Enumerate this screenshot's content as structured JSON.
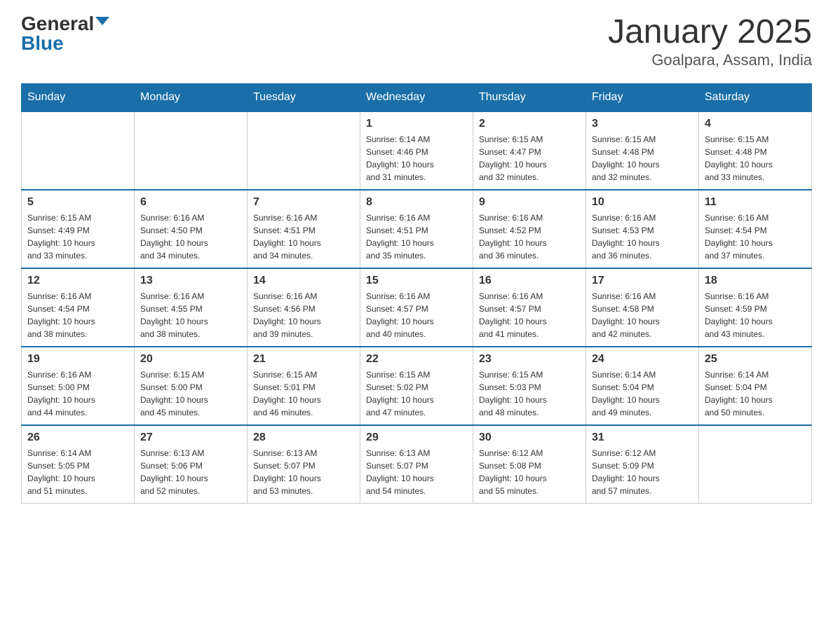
{
  "header": {
    "logo_general": "General",
    "logo_blue": "Blue",
    "title": "January 2025",
    "subtitle": "Goalpara, Assam, India"
  },
  "weekdays": [
    "Sunday",
    "Monday",
    "Tuesday",
    "Wednesday",
    "Thursday",
    "Friday",
    "Saturday"
  ],
  "weeks": [
    [
      {
        "day": "",
        "info": ""
      },
      {
        "day": "",
        "info": ""
      },
      {
        "day": "",
        "info": ""
      },
      {
        "day": "1",
        "info": "Sunrise: 6:14 AM\nSunset: 4:46 PM\nDaylight: 10 hours\nand 31 minutes."
      },
      {
        "day": "2",
        "info": "Sunrise: 6:15 AM\nSunset: 4:47 PM\nDaylight: 10 hours\nand 32 minutes."
      },
      {
        "day": "3",
        "info": "Sunrise: 6:15 AM\nSunset: 4:48 PM\nDaylight: 10 hours\nand 32 minutes."
      },
      {
        "day": "4",
        "info": "Sunrise: 6:15 AM\nSunset: 4:48 PM\nDaylight: 10 hours\nand 33 minutes."
      }
    ],
    [
      {
        "day": "5",
        "info": "Sunrise: 6:15 AM\nSunset: 4:49 PM\nDaylight: 10 hours\nand 33 minutes."
      },
      {
        "day": "6",
        "info": "Sunrise: 6:16 AM\nSunset: 4:50 PM\nDaylight: 10 hours\nand 34 minutes."
      },
      {
        "day": "7",
        "info": "Sunrise: 6:16 AM\nSunset: 4:51 PM\nDaylight: 10 hours\nand 34 minutes."
      },
      {
        "day": "8",
        "info": "Sunrise: 6:16 AM\nSunset: 4:51 PM\nDaylight: 10 hours\nand 35 minutes."
      },
      {
        "day": "9",
        "info": "Sunrise: 6:16 AM\nSunset: 4:52 PM\nDaylight: 10 hours\nand 36 minutes."
      },
      {
        "day": "10",
        "info": "Sunrise: 6:16 AM\nSunset: 4:53 PM\nDaylight: 10 hours\nand 36 minutes."
      },
      {
        "day": "11",
        "info": "Sunrise: 6:16 AM\nSunset: 4:54 PM\nDaylight: 10 hours\nand 37 minutes."
      }
    ],
    [
      {
        "day": "12",
        "info": "Sunrise: 6:16 AM\nSunset: 4:54 PM\nDaylight: 10 hours\nand 38 minutes."
      },
      {
        "day": "13",
        "info": "Sunrise: 6:16 AM\nSunset: 4:55 PM\nDaylight: 10 hours\nand 38 minutes."
      },
      {
        "day": "14",
        "info": "Sunrise: 6:16 AM\nSunset: 4:56 PM\nDaylight: 10 hours\nand 39 minutes."
      },
      {
        "day": "15",
        "info": "Sunrise: 6:16 AM\nSunset: 4:57 PM\nDaylight: 10 hours\nand 40 minutes."
      },
      {
        "day": "16",
        "info": "Sunrise: 6:16 AM\nSunset: 4:57 PM\nDaylight: 10 hours\nand 41 minutes."
      },
      {
        "day": "17",
        "info": "Sunrise: 6:16 AM\nSunset: 4:58 PM\nDaylight: 10 hours\nand 42 minutes."
      },
      {
        "day": "18",
        "info": "Sunrise: 6:16 AM\nSunset: 4:59 PM\nDaylight: 10 hours\nand 43 minutes."
      }
    ],
    [
      {
        "day": "19",
        "info": "Sunrise: 6:16 AM\nSunset: 5:00 PM\nDaylight: 10 hours\nand 44 minutes."
      },
      {
        "day": "20",
        "info": "Sunrise: 6:15 AM\nSunset: 5:00 PM\nDaylight: 10 hours\nand 45 minutes."
      },
      {
        "day": "21",
        "info": "Sunrise: 6:15 AM\nSunset: 5:01 PM\nDaylight: 10 hours\nand 46 minutes."
      },
      {
        "day": "22",
        "info": "Sunrise: 6:15 AM\nSunset: 5:02 PM\nDaylight: 10 hours\nand 47 minutes."
      },
      {
        "day": "23",
        "info": "Sunrise: 6:15 AM\nSunset: 5:03 PM\nDaylight: 10 hours\nand 48 minutes."
      },
      {
        "day": "24",
        "info": "Sunrise: 6:14 AM\nSunset: 5:04 PM\nDaylight: 10 hours\nand 49 minutes."
      },
      {
        "day": "25",
        "info": "Sunrise: 6:14 AM\nSunset: 5:04 PM\nDaylight: 10 hours\nand 50 minutes."
      }
    ],
    [
      {
        "day": "26",
        "info": "Sunrise: 6:14 AM\nSunset: 5:05 PM\nDaylight: 10 hours\nand 51 minutes."
      },
      {
        "day": "27",
        "info": "Sunrise: 6:13 AM\nSunset: 5:06 PM\nDaylight: 10 hours\nand 52 minutes."
      },
      {
        "day": "28",
        "info": "Sunrise: 6:13 AM\nSunset: 5:07 PM\nDaylight: 10 hours\nand 53 minutes."
      },
      {
        "day": "29",
        "info": "Sunrise: 6:13 AM\nSunset: 5:07 PM\nDaylight: 10 hours\nand 54 minutes."
      },
      {
        "day": "30",
        "info": "Sunrise: 6:12 AM\nSunset: 5:08 PM\nDaylight: 10 hours\nand 55 minutes."
      },
      {
        "day": "31",
        "info": "Sunrise: 6:12 AM\nSunset: 5:09 PM\nDaylight: 10 hours\nand 57 minutes."
      },
      {
        "day": "",
        "info": ""
      }
    ]
  ]
}
